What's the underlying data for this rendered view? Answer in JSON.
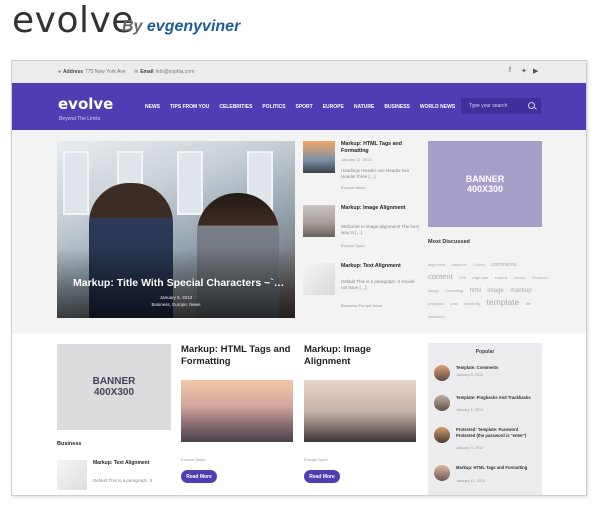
{
  "page": {
    "title": "evolve",
    "byline_prefix": "By",
    "author": "evgenyviner"
  },
  "site": {
    "topbar": {
      "address_label": "Address",
      "address_value": "775 New York Ave",
      "email_label": "Email",
      "email_value": "info@sophia.com"
    },
    "logo": "evolve",
    "tagline": "Beyond The Limits",
    "menu": [
      "NEWS",
      "TIPS FROM YOU",
      "CELEBRITIES",
      "POLITICS",
      "SPORT",
      "EUROPE",
      "NATURE",
      "BUSINESS",
      "WORLD NEWS"
    ],
    "search_placeholder": "Type your search",
    "hero": {
      "title": "Markup: Title With Special Characters ~`…",
      "date": "January 5, 2013",
      "categories": "Business, Europe, News"
    },
    "side_posts": [
      {
        "title": "Markup: HTML Tags and Formatting",
        "date": "January 11, 2013",
        "excerpt": "Headings Header one Header two Header three […]",
        "category": "Europe News"
      },
      {
        "title": "Markup: Image Alignment",
        "date": "January 10, 2013",
        "excerpt": "Welcome to image alignment! The best way to […]",
        "category": "Europe Sport"
      },
      {
        "title": "Markup: Text Alignment",
        "date": "January 9, 2013",
        "excerpt": "Default This is a paragraph. It should not have […]",
        "category": "Business Europe News"
      }
    ],
    "banner_top": {
      "line1": "BANNER",
      "line2": "400X300"
    },
    "most_discussed_title": "Most Discussed",
    "tags": [
      "alignment",
      "captions",
      "Codex",
      "comments",
      "content",
      "css",
      "edge case",
      "embeds",
      "excerpt",
      "Featured image",
      "formatting",
      "html",
      "image",
      "markup",
      "pingbacks",
      "post",
      "readability",
      "template",
      "title",
      "trackbacks"
    ],
    "lower_cards": [
      {
        "title": "Markup: HTML Tags and Formatting",
        "category": "Europe News",
        "button": "Read More"
      },
      {
        "title": "Markup: Image Alignment",
        "category": "Europe Sport",
        "button": "Read More"
      }
    ],
    "banner_bottom": {
      "line1": "BANNER",
      "line2": "400X300"
    },
    "business": {
      "heading": "Business",
      "item_title": "Markup: Text Alignment",
      "item_excerpt": "Default This is a paragraph. It"
    },
    "popular": {
      "heading": "Popular",
      "items": [
        {
          "title": "Template: Comments",
          "date": "January 3, 2012"
        },
        {
          "title": "Template: Pingbacks And Trackbacks",
          "date": "January 1, 2013"
        },
        {
          "title": "Protected: Template: Password Protected (the password is \"enter\")",
          "date": "January 4, 2012"
        },
        {
          "title": "Markup: HTML Tags and Formatting",
          "date": "January 11, 2013"
        }
      ]
    }
  }
}
